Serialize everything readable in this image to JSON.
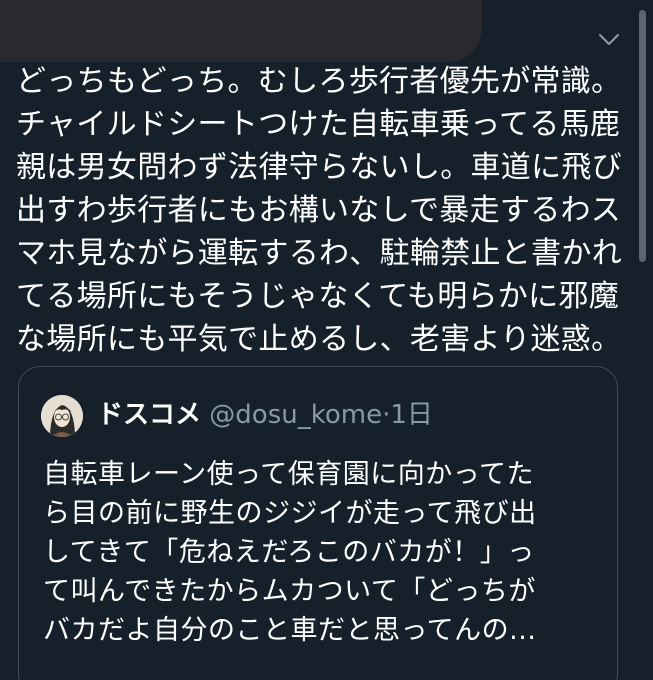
{
  "tweet": {
    "text": "どっちもどっち。むしろ歩行者優先が常識。\nチャイルドシートつけた自転車乗ってる馬鹿\n親は男女問わず法律守らないし。車道に飛び\n出すわ歩行者にもお構いなしで暴走するわス\nマホ見ながら運転するわ、駐輪禁止と書かれ\nてる場所にもそうじゃなくても明らかに邪魔\nな場所にも平気で止めるし、老害より迷惑。"
  },
  "quote": {
    "name": "ドスコメ",
    "handle": "@dosu_kome",
    "separator": "·",
    "time": "1日",
    "text": "自転車レーン使って保育園に向かってた\nら目の前に野生のジジイが走って飛び出\nしてきて「危ねえだろこのバカが！」っ\nて叫んできたからムカついて「どっちが\nバカだよ自分のこと車だと思ってんの..."
  },
  "icons": {
    "more": "chevron-down-icon"
  },
  "colors": {
    "background": "#15202b",
    "secondary_text": "#8899a6",
    "border": "#3d4b58"
  }
}
